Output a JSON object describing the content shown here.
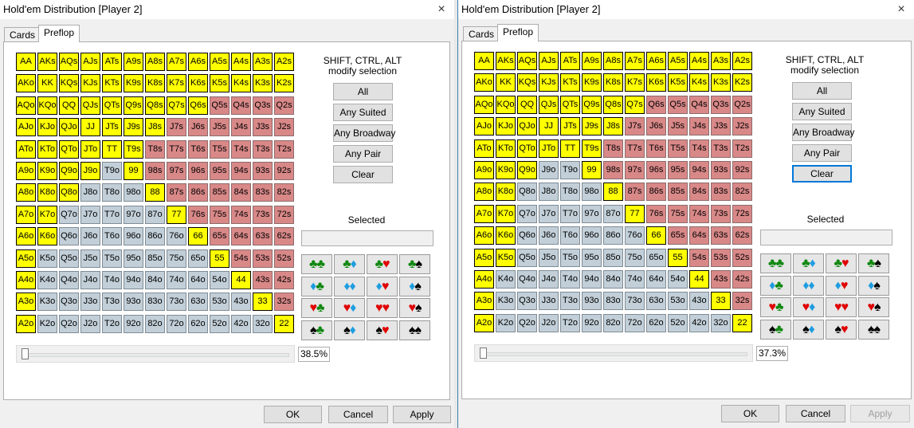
{
  "ranks": [
    "A",
    "K",
    "Q",
    "J",
    "T",
    "9",
    "8",
    "7",
    "6",
    "5",
    "4",
    "3",
    "2"
  ],
  "colors": {
    "selected": "#ffff00",
    "suited": "#d98888",
    "offsuit": "#c2cfd8",
    "accent": "#0078d7"
  },
  "suit_buttons": [
    [
      [
        "club",
        "club"
      ],
      [
        "club",
        "diamond"
      ],
      [
        "club",
        "heart"
      ],
      [
        "club",
        "spade"
      ]
    ],
    [
      [
        "diamond",
        "club"
      ],
      [
        "diamond",
        "diamond"
      ],
      [
        "diamond",
        "heart"
      ],
      [
        "diamond",
        "spade"
      ]
    ],
    [
      [
        "heart",
        "club"
      ],
      [
        "heart",
        "diamond"
      ],
      [
        "heart",
        "heart"
      ],
      [
        "heart",
        "spade"
      ]
    ],
    [
      [
        "spade",
        "club"
      ],
      [
        "spade",
        "diamond"
      ],
      [
        "spade",
        "heart"
      ],
      [
        "spade",
        "spade"
      ]
    ]
  ],
  "suit_glyphs": {
    "club": "♣",
    "diamond": "♦",
    "heart": "♥",
    "spade": "♠"
  },
  "windows": [
    {
      "title": "Hold'em Distribution [Player 2]",
      "close_icon": "×",
      "tabs": [
        "Cards",
        "Preflop"
      ],
      "active_tab": "Preflop",
      "hint_line1": "SHIFT, CTRL, ALT",
      "hint_line2": "modify selection",
      "buttons": [
        "All",
        "Any Suited",
        "Any Broadway",
        "Any Pair",
        "Clear"
      ],
      "focused_button": "",
      "selected_label": "Selected",
      "selected_value": "",
      "slider_percent": "38.5%",
      "footer": {
        "ok": "OK",
        "cancel": "Cancel",
        "apply": "Apply",
        "apply_disabled": false
      },
      "selected_hands": [
        "AA",
        "AKs",
        "AQs",
        "AJs",
        "ATs",
        "A9s",
        "A8s",
        "A7s",
        "A6s",
        "A5s",
        "A4s",
        "A3s",
        "A2s",
        "AKo",
        "KK",
        "KQs",
        "KJs",
        "KTs",
        "K9s",
        "K8s",
        "K7s",
        "K6s",
        "K5s",
        "K4s",
        "K3s",
        "K2s",
        "AQo",
        "KQo",
        "QQ",
        "QJs",
        "QTs",
        "Q9s",
        "Q8s",
        "Q7s",
        "Q6s",
        "AJo",
        "KJo",
        "QJo",
        "JJ",
        "JTs",
        "J9s",
        "J8s",
        "ATo",
        "KTo",
        "QTo",
        "JTo",
        "TT",
        "T9s",
        "A9o",
        "K9o",
        "Q9o",
        "J9o",
        "99",
        "A8o",
        "K8o",
        "Q8o",
        "88",
        "A7o",
        "K7o",
        "77",
        "A6o",
        "K6o",
        "66",
        "A5o",
        "55",
        "A4o",
        "44",
        "A3o",
        "33",
        "A2o",
        "22"
      ]
    },
    {
      "title": "Hold'em Distribution [Player 2]",
      "close_icon": "×",
      "tabs": [
        "Cards",
        "Preflop"
      ],
      "active_tab": "Preflop",
      "hint_line1": "SHIFT, CTRL, ALT",
      "hint_line2": "modify selection",
      "buttons": [
        "All",
        "Any Suited",
        "Any Broadway",
        "Any Pair",
        "Clear"
      ],
      "focused_button": "Clear",
      "selected_label": "Selected",
      "selected_value": "",
      "slider_percent": "37.3%",
      "footer": {
        "ok": "OK",
        "cancel": "Cancel",
        "apply": "Apply",
        "apply_disabled": true
      },
      "selected_hands": [
        "AA",
        "AKs",
        "AQs",
        "AJs",
        "ATs",
        "A9s",
        "A8s",
        "A7s",
        "A6s",
        "A5s",
        "A4s",
        "A3s",
        "A2s",
        "AKo",
        "KK",
        "KQs",
        "KJs",
        "KTs",
        "K9s",
        "K8s",
        "K7s",
        "K6s",
        "K5s",
        "K4s",
        "K3s",
        "K2s",
        "AQo",
        "KQo",
        "QQ",
        "QJs",
        "QTs",
        "Q9s",
        "Q8s",
        "Q7s",
        "AJo",
        "KJo",
        "QJo",
        "JJ",
        "JTs",
        "J9s",
        "J8s",
        "ATo",
        "KTo",
        "QTo",
        "JTo",
        "TT",
        "T9s",
        "A9o",
        "K9o",
        "Q9o",
        "99",
        "A8o",
        "K8o",
        "88",
        "A7o",
        "K7o",
        "77",
        "A6o",
        "K6o",
        "66",
        "A5o",
        "K5o",
        "55",
        "A4o",
        "44",
        "A3o",
        "33",
        "A2o",
        "22"
      ]
    }
  ]
}
